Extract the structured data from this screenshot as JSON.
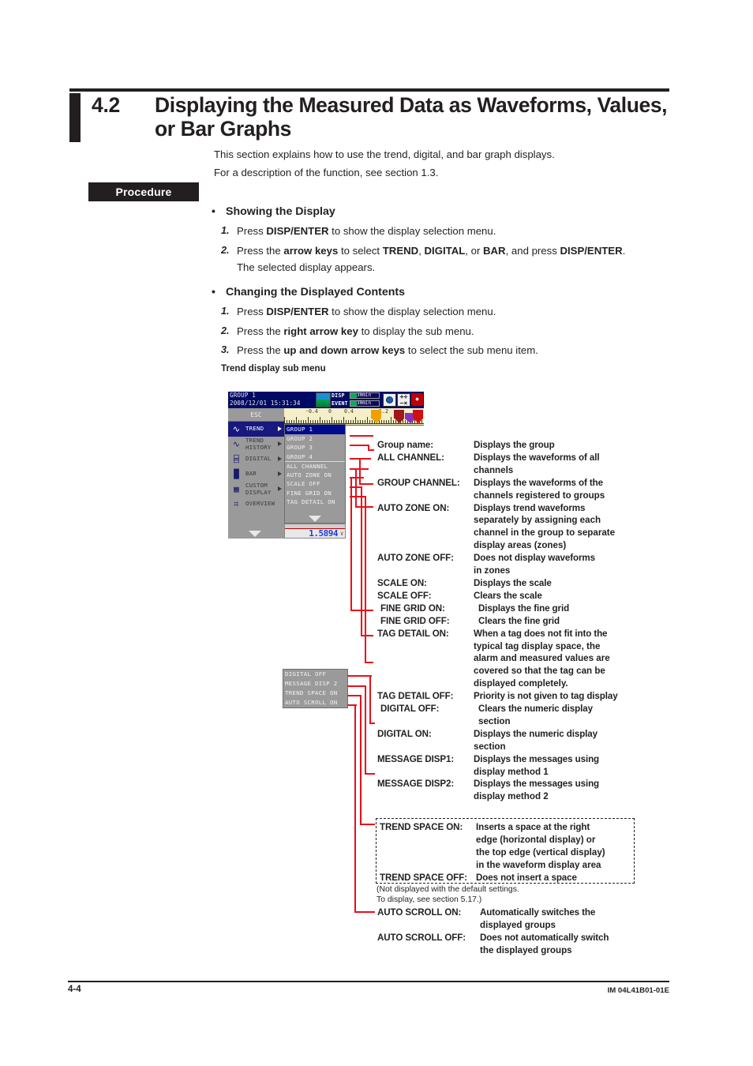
{
  "header": {
    "section_number": "4.2",
    "section_title": "Displaying the Measured Data as Waveforms, Values, or Bar Graphs",
    "intro_line_1": "This section explains how to use the trend, digital, and bar graph displays.",
    "intro_line_2": "For a description of the function, see section 1.3."
  },
  "procedure_tag": "Procedure",
  "procedure": {
    "group1_heading": "Showing the Display",
    "group1_steps": [
      {
        "num": "1.",
        "html": "Press <b>DISP/ENTER</b> to show the display selection menu."
      },
      {
        "num": "2.",
        "html": "Press the <b>arrow keys</b> to select <b>TREND</b>, <b>DIGITAL</b>, or <b>BAR</b>, and press <b>DISP/ENTER</b>."
      }
    ],
    "group1_note": "The selected display appears.",
    "group2_heading": "Changing the Displayed Contents",
    "group2_steps": [
      {
        "num": "1.",
        "html": "Press <b>DISP/ENTER</b> to show the display selection menu."
      },
      {
        "num": "2.",
        "html": "Press the <b>right arrow key</b> to display the sub menu."
      },
      {
        "num": "3.",
        "html": "Press the <b>up and down arrow keys</b> to select the sub menu item."
      }
    ],
    "figure_caption": "Trend display sub menu"
  },
  "device": {
    "group_label": "GROUP 1",
    "datetime": "2008/12/01 15:31:34",
    "disp_label": "DISP",
    "event_label": "EVENT",
    "disp_rate": "30min",
    "event_rate": "30min",
    "esc_label": "ESC",
    "menu_items": [
      {
        "icon": "trend-icon",
        "label": "TREND",
        "selected": true,
        "arrow": true
      },
      {
        "icon": "trend-history-icon",
        "label": "TREND\nHISTORY",
        "selected": false,
        "arrow": true
      },
      {
        "icon": "digital-icon",
        "label": "DIGITAL",
        "selected": false,
        "arrow": true
      },
      {
        "icon": "bar-icon",
        "label": "BAR",
        "selected": false,
        "arrow": true
      },
      {
        "icon": "custom-display-icon",
        "label": "CUSTOM\nDISPLAY",
        "selected": false,
        "arrow": true
      },
      {
        "icon": "overview-icon",
        "label": "OVERVIEW",
        "selected": false,
        "arrow": false
      }
    ],
    "submenu_items": [
      {
        "label": "GROUP 1",
        "selected": true,
        "divider": false
      },
      {
        "label": "GROUP 2",
        "selected": false,
        "divider": false
      },
      {
        "label": "GROUP 3",
        "selected": false,
        "divider": false
      },
      {
        "label": "GROUP 4",
        "selected": false,
        "divider": false
      },
      {
        "label": "ALL CHANNEL",
        "selected": false,
        "divider": true
      },
      {
        "label": "AUTO ZONE ON",
        "selected": false,
        "divider": false
      },
      {
        "label": "SCALE OFF",
        "selected": false,
        "divider": false
      },
      {
        "label": "FINE GRID ON",
        "selected": false,
        "divider": false
      },
      {
        "label": "TAG DETAIL ON",
        "selected": false,
        "divider": false
      }
    ],
    "ruler_labels": [
      "-0.4",
      "0",
      "0.4",
      "1.2"
    ],
    "markers": [
      {
        "num": "6",
        "color": "#f0a000"
      },
      {
        "num": "5",
        "color": "#a01818"
      },
      {
        "num": "1",
        "color": "#d01010"
      }
    ],
    "digital_value": "1.5894",
    "digital_unit": "V"
  },
  "device_submenu2": {
    "items": [
      {
        "label": "DIGITAL OFF"
      },
      {
        "label": "MESSAGE DISP 2"
      },
      {
        "label": "TREND SPACE ON"
      },
      {
        "label": "AUTO SCROLL ON"
      }
    ]
  },
  "descriptions": [
    {
      "term": "Group name:",
      "def": "Displays the group",
      "cont": []
    },
    {
      "term": "ALL CHANNEL:",
      "def": "Displays the waveforms of all",
      "cont": [
        "channels"
      ]
    },
    {
      "term": "GROUP CHANNEL:",
      "def": "Displays the waveforms of the",
      "cont": [
        "channels registered to groups"
      ]
    },
    {
      "term": "AUTO ZONE ON:",
      "def": "Displays trend waveforms",
      "cont": [
        "separately by assigning each",
        "channel in the group to separate",
        "display areas (zones)"
      ]
    },
    {
      "term": "AUTO ZONE OFF:",
      "def": "Does not display waveforms",
      "cont": [
        "in zones"
      ]
    },
    {
      "term": "SCALE ON:",
      "def": "Displays the scale",
      "cont": []
    },
    {
      "term": "SCALE OFF:",
      "def": "Clears the scale",
      "cont": []
    },
    {
      "term": "FINE GRID ON:",
      "def": "Displays the fine grid",
      "cont": []
    },
    {
      "term": "FINE GRID OFF:",
      "def": "Clears the fine grid",
      "cont": []
    },
    {
      "term": "TAG DETAIL ON:",
      "def": "When a tag does not fit into the",
      "cont": [
        "typical tag display space, the",
        "alarm and measured values are",
        "covered so that the tag can be",
        "displayed completely."
      ]
    },
    {
      "term": "TAG DETAIL OFF:",
      "def": "Priority is not given to tag display",
      "cont": []
    },
    {
      "term": "DIGITAL OFF:",
      "def": "Clears the numeric display",
      "cont": [
        "section"
      ]
    },
    {
      "term": "DIGITAL ON:",
      "def": "Displays the numeric display",
      "cont": [
        "section"
      ]
    },
    {
      "term": "MESSAGE DISP1:",
      "def": "Displays the messages using",
      "cont": [
        "display method 1"
      ]
    },
    {
      "term": "MESSAGE DISP2:",
      "def": "Displays the messages using",
      "cont": [
        "display method 2"
      ]
    }
  ],
  "trend_space": {
    "on_term": "TREND SPACE ON:",
    "on_def": "Inserts a space at the right",
    "on_cont": [
      "edge (horizontal display) or",
      "the top edge (vertical display)",
      "in the waveform display area"
    ],
    "off_term": "TREND SPACE OFF:",
    "off_def": "Does not insert a space",
    "note_line_1": "(Not displayed with the default settings.",
    "note_line_2": "To display, see section 5.17.)"
  },
  "auto_scroll": [
    {
      "term": "AUTO SCROLL ON:",
      "def": "Automatically switches the",
      "cont": [
        "displayed groups"
      ]
    },
    {
      "term": "AUTO SCROLL OFF:",
      "def": "Does not automatically switch",
      "cont": [
        "the displayed groups"
      ]
    }
  ],
  "footer": {
    "page_number": "4-4",
    "doc_code": "IM 04L41B01-01E"
  }
}
